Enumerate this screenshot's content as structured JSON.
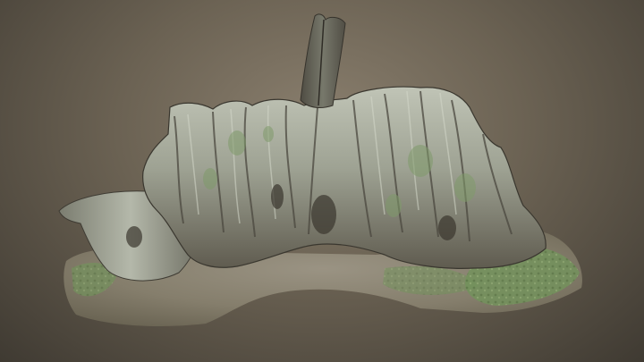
{
  "viewer": {
    "background_colors": [
      "#8a7f6e",
      "#6b6253",
      "#3f3a32"
    ],
    "subject": "tree-stump-3d-scan"
  },
  "colors": {
    "bark_light": "#b7bcae",
    "bark_mid": "#8b8f82",
    "bark_dark": "#4e4a40",
    "moss": "#6f8f5a",
    "ground": "#8a8373"
  }
}
